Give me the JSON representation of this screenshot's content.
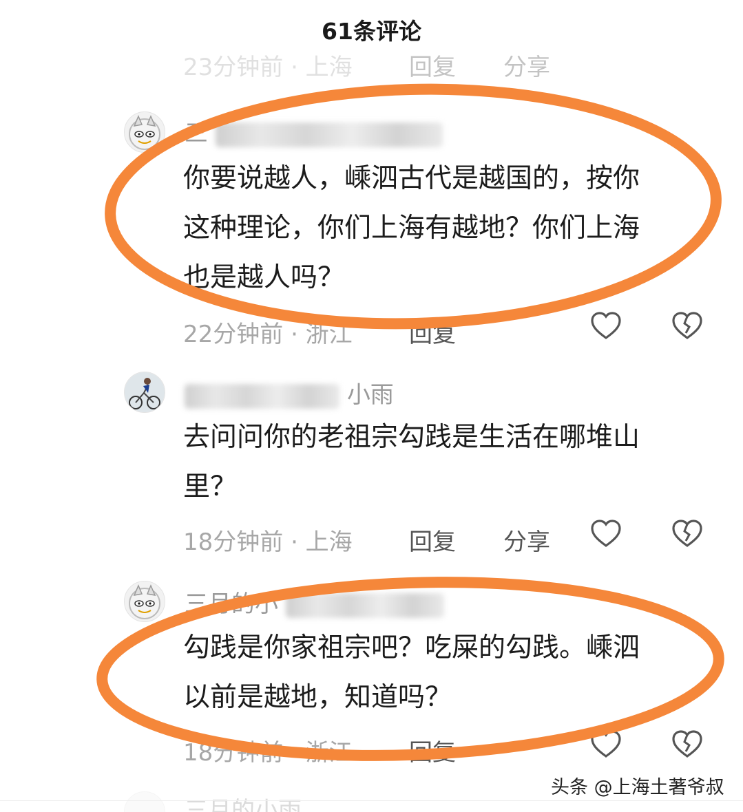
{
  "header": {
    "title": "61条评论"
  },
  "comments": [
    {
      "username_visible": "",
      "text_lines": [],
      "time": "23分钟前 · 上海",
      "reply": "回复",
      "share": "分享"
    },
    {
      "username_visible": "三",
      "text_lines": [
        "你要说越人，嵊泗古代是越国的，按你",
        "这种理论，你们上海有越地？你们上海",
        "也是越人吗？"
      ],
      "time": "22分钟前 · 浙江",
      "reply": "回复",
      "share": ""
    },
    {
      "username_visible": "小雨",
      "text_lines": [
        "去问问你的老祖宗勾践是生活在哪堆山",
        "里？"
      ],
      "time": "18分钟前 · 上海",
      "reply": "回复",
      "share": "分享"
    },
    {
      "username_visible": "三月的小",
      "text_lines": [
        "勾践是你家祖宗吧？吃屎的勾践。嵊泗",
        "以前是越地，知道吗？"
      ],
      "time": "18分钟前 · 浙江",
      "reply": "回复",
      "share": ""
    },
    {
      "username_visible": "三月的小雨",
      "text_lines": [],
      "time": "",
      "reply": "",
      "share": ""
    }
  ],
  "watermark": "头条 @上海土著爷叔",
  "colors": {
    "highlight": "#f5873a",
    "meta": "#a7a7a7",
    "text": "#1c1c1c"
  },
  "icons": {
    "like": "heart-outline-icon",
    "dislike": "broken-heart-icon"
  }
}
